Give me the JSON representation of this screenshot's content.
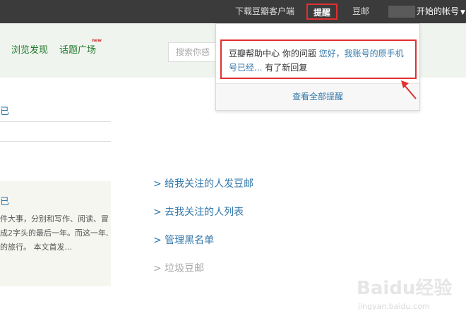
{
  "topbar": {
    "download_client": "下载豆瓣客户端",
    "reminders": "提醒",
    "mail": "豆邮",
    "account": "开始的帐号",
    "account_chevron": "caret-down-icon"
  },
  "nav": {
    "browse": "浏览发现",
    "topics": "话题广场",
    "new_badge": "new",
    "search_placeholder": "搜索你感"
  },
  "dropdown": {
    "notif_prefix": "豆瓣帮助中心 你的问题 ",
    "notif_link": "您好，我账号的原手机号已经...",
    "notif_suffix": " 有了新回复",
    "see_all": "查看全部提醒",
    "highlight_color": "#e03030"
  },
  "left": {
    "line1": "已",
    "card_title": "已",
    "card_l1": "件大事，分别和写作、阅读、冒",
    "card_l2": "成2字头的最后一年。而这一年,",
    "card_l3": "的旅行。 本文首发..."
  },
  "links": {
    "send_mail": "> 给我关注的人发豆邮",
    "goto_list": "> 去我关注的人列表",
    "blacklist": "> 管理黑名单",
    "spam": "> 垃圾豆邮"
  },
  "watermark": {
    "brand": "Baidu经验",
    "url": "jingyan.baidu.com"
  }
}
